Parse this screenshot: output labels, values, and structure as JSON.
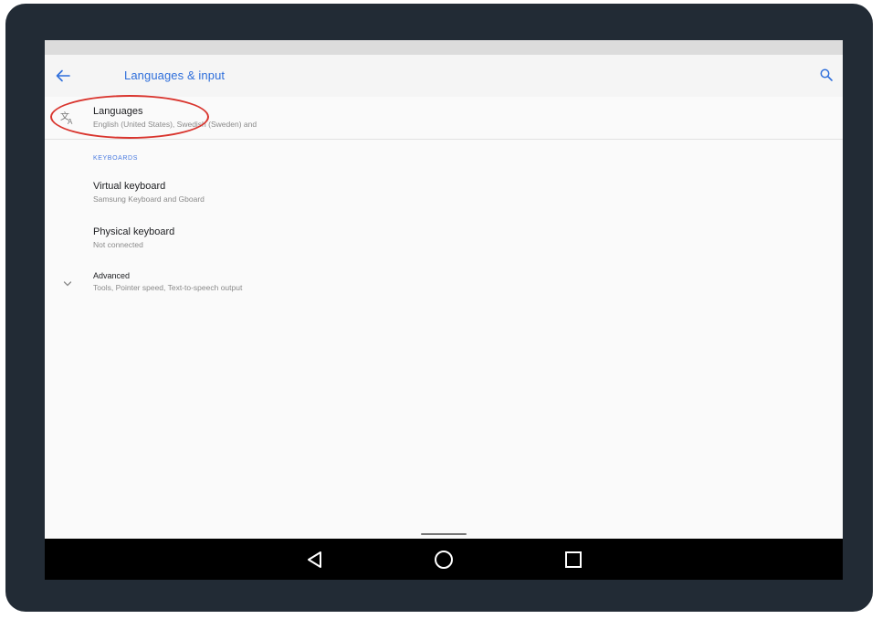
{
  "app_bar": {
    "title": "Languages & input",
    "back_icon": "arrow-left-icon",
    "search_icon": "search-icon"
  },
  "languages": {
    "title": "Languages",
    "summary": "English (United States), Swedish (Sweden) and",
    "icon": "translate-icon"
  },
  "keyboards_section": {
    "header": "KEYBOARDS",
    "virtual": {
      "title": "Virtual keyboard",
      "summary": "Samsung Keyboard and Gboard"
    },
    "physical": {
      "title": "Physical keyboard",
      "summary": "Not connected"
    }
  },
  "advanced": {
    "title": "Advanced",
    "summary": "Tools, Pointer speed, Text-to-speech output",
    "icon": "chevron-down-icon"
  },
  "nav_bar": {
    "back_icon": "triangle-back-icon",
    "home_icon": "circle-home-icon",
    "recents_icon": "square-recents-icon"
  },
  "colors": {
    "accent": "#2f6fdb",
    "highlight": "#d9352e",
    "bezel": "#222b35"
  }
}
